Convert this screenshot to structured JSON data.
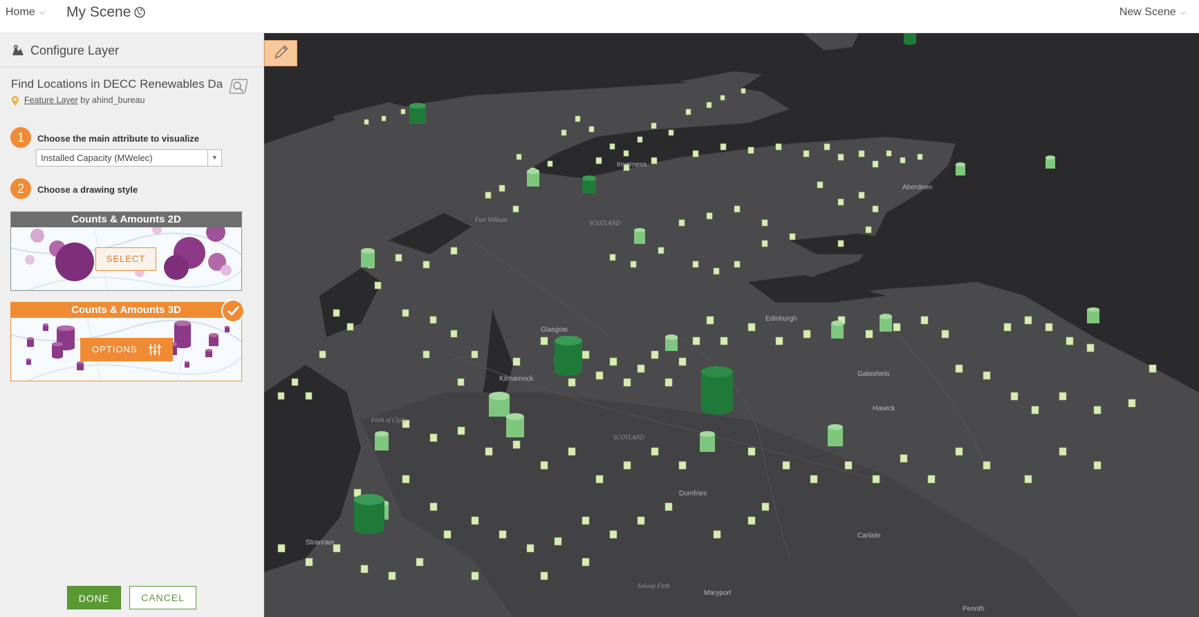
{
  "topbar": {
    "home_label": "Home",
    "scene_title": "My Scene",
    "new_scene_label": "New Scene"
  },
  "panel": {
    "title": "Configure Layer",
    "layer_name": "Find Locations in DECC Renewables Da...",
    "layer_type_link": "Feature Layer",
    "layer_owner": " by ahind_bureau",
    "step1": {
      "number": "1",
      "label": "Choose the main attribute to visualize"
    },
    "attribute_select_value": "Installed Capacity (MWelec)",
    "step2": {
      "number": "2",
      "label": "Choose a drawing style"
    },
    "style_2d": {
      "title": "Counts & Amounts 2D",
      "button": "SELECT"
    },
    "style_3d": {
      "title": "Counts & Amounts 3D",
      "button": "OPTIONS",
      "selected": true
    },
    "done_label": "DONE",
    "cancel_label": "CANCEL"
  },
  "map": {
    "labels": {
      "scotland_north": "SCOTLAND",
      "scotland_south": "SCOTLAND",
      "fort_william": "Fort William",
      "firth_of_clyde": "Firth of Clyde",
      "solway_firth": "Solway Firth"
    },
    "cities": {
      "aberdeen": "Aberdeen",
      "edinburgh": "Edinburgh",
      "glasgow": "Glasgow",
      "kilmarnock": "Kilmarnock",
      "dumfries": "Dumfries",
      "stranraer": "Stranraer",
      "carlisle": "Carlisle",
      "maryport": "Maryport",
      "penrith": "Penrith",
      "galashiels": "Galashiels",
      "hawick": "Hawick",
      "inverness": "Inverness"
    },
    "colors": {
      "small_feature": "#d7ecb0",
      "medium_feature": "#7fc77e",
      "large_feature": "#1f7a3a"
    }
  }
}
